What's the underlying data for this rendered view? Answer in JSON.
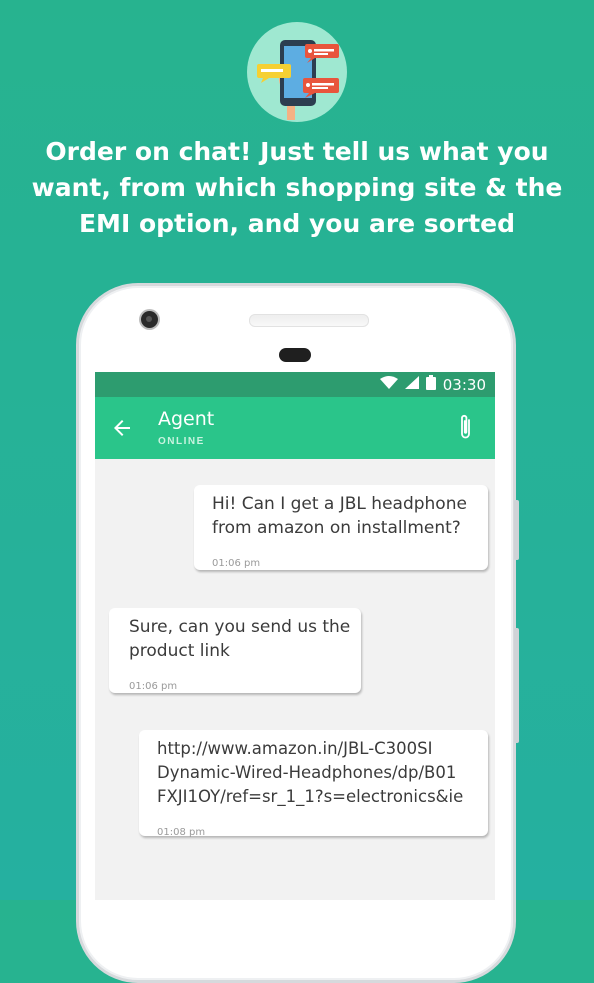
{
  "headline": {
    "line1": "Order on chat! Just tell us what you",
    "line2": "want, from which shopping site &  the",
    "line3": "EMI option, and you are sorted"
  },
  "hero_icon": "chat-on-phone-illustration",
  "status_bar": {
    "time": "03:30",
    "icons": [
      "wifi-icon",
      "signal-icon",
      "battery-icon"
    ]
  },
  "chat_header": {
    "title": "Agent",
    "status": "ONLINE",
    "back_icon": "back-arrow-icon",
    "attach_icon": "paperclip-icon"
  },
  "messages": [
    {
      "side": "right",
      "lines": [
        "Hi! Can I get a JBL headphone",
        "from amazon on installment?"
      ],
      "time": "01:06 pm"
    },
    {
      "side": "left",
      "lines": [
        "Sure, can you send us the",
        "product link"
      ],
      "time": "01:06 pm"
    },
    {
      "side": "right",
      "lines": [
        "http://www.amazon.in/JBL-C300SI",
        "Dynamic-Wired-Headphones/dp/B01",
        "FXJI1OY/ref=sr_1_1?s=electronics&ie"
      ],
      "time": "01:08 pm"
    }
  ],
  "colors": {
    "background": "#27b38f",
    "status_bar": "#2d9c6f",
    "app_bar": "#2ac58a",
    "chat_background": "#f2f2f2"
  }
}
